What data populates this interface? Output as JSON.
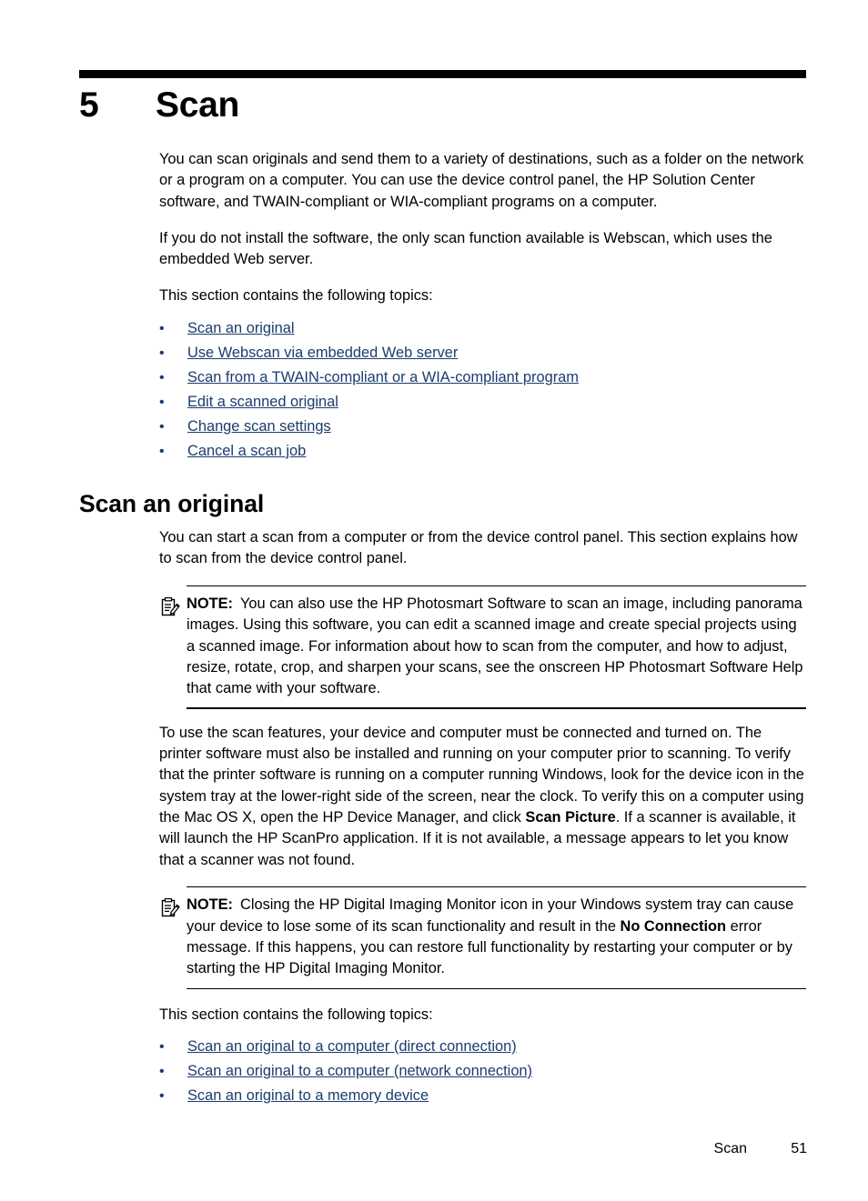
{
  "chapter": {
    "number": "5",
    "title": "Scan"
  },
  "intro": {
    "paragraph1": "You can scan originals and send them to a variety of destinations, such as a folder on the network or a program on a computer. You can use the device control panel, the HP Solution Center software, and TWAIN-compliant or WIA-compliant programs on a computer.",
    "paragraph2": "If you do not install the software, the only scan function available is Webscan, which uses the embedded Web server.",
    "topics_lead": "This section contains the following topics:",
    "topics": [
      "Scan an original",
      "Use Webscan via embedded Web server",
      "Scan from a TWAIN-compliant or a WIA-compliant program",
      "Edit a scanned original",
      "Change scan settings",
      "Cancel a scan job"
    ]
  },
  "section": {
    "heading": "Scan an original",
    "paragraph1": "You can start a scan from a computer or from the device control panel. This section explains how to scan from the device control panel.",
    "note1": {
      "icon": "note-clipboard-pencil-icon",
      "label": "NOTE:",
      "text": "You can also use the HP Photosmart Software to scan an image, including panorama images. Using this software, you can edit a scanned image and create special projects using a scanned image. For information about how to scan from the computer, and how to adjust, resize, rotate, crop, and sharpen your scans, see the onscreen HP Photosmart Software Help that came with your software."
    },
    "paragraph2_part1": "To use the scan features, your device and computer must be connected and turned on. The printer software must also be installed and running on your computer prior to scanning. To verify that the printer software is running on a computer running Windows, look for the device icon in the system tray at the lower-right side of the screen, near the clock. To verify this on a computer using the Mac OS X, open the HP Device Manager, and click ",
    "paragraph2_bold": "Scan Picture",
    "paragraph2_part2": ". If a scanner is available, it will launch the HP ScanPro application. If it is not available, a message appears to let you know that a scanner was not found.",
    "note2": {
      "icon": "note-clipboard-pencil-icon",
      "label": "NOTE:",
      "text_part1": "Closing the HP Digital Imaging Monitor icon in your Windows system tray can cause your device to lose some of its scan functionality and result in the ",
      "text_bold1": "No Connection",
      "text_part2": " error message. If this happens, you can restore full functionality by restarting your computer or by starting the HP Digital Imaging Monitor."
    },
    "topics_lead": "This section contains the following topics:",
    "topics": [
      "Scan an original to a computer (direct connection)",
      "Scan an original to a computer (network connection)",
      "Scan an original to a memory device"
    ]
  },
  "footer": {
    "chapter_name": "Scan",
    "page_number": "51"
  },
  "colors": {
    "link": "#1b3c6e",
    "text": "#000000",
    "rule": "#000000",
    "background": "#ffffff"
  },
  "bullet_glyph": "•"
}
